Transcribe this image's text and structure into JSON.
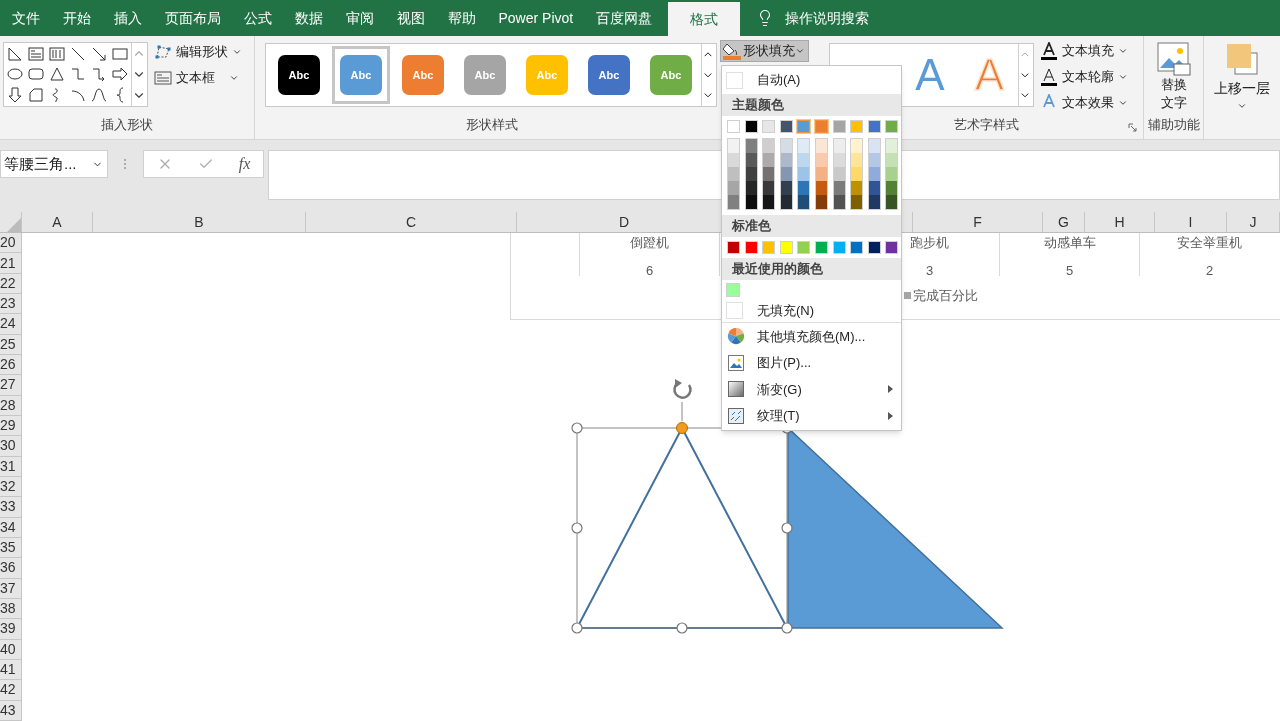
{
  "tabs": [
    {
      "label": "文件",
      "selected": false
    },
    {
      "label": "开始",
      "selected": false
    },
    {
      "label": "插入",
      "selected": false
    },
    {
      "label": "页面布局",
      "selected": false
    },
    {
      "label": "公式",
      "selected": false
    },
    {
      "label": "数据",
      "selected": false
    },
    {
      "label": "审阅",
      "selected": false
    },
    {
      "label": "视图",
      "selected": false
    },
    {
      "label": "帮助",
      "selected": false
    },
    {
      "label": "Power Pivot",
      "selected": false
    },
    {
      "label": "百度网盘",
      "selected": false
    },
    {
      "label": "格式",
      "selected": true
    }
  ],
  "search": {
    "label": "操作说明搜索"
  },
  "insert_shapes": {
    "buttons": [
      "编辑形状",
      "文本框"
    ],
    "label": "插入形状"
  },
  "shape_styles": {
    "label": "形状样式",
    "styles": [
      {
        "text": "Abc",
        "color": "#000000",
        "selected": false
      },
      {
        "text": "Abc",
        "color": "#5b9bd5",
        "selected": true
      },
      {
        "text": "Abc",
        "color": "#ed7d31",
        "selected": false
      },
      {
        "text": "Abc",
        "color": "#a5a5a5",
        "selected": false
      },
      {
        "text": "Abc",
        "color": "#ffc000",
        "selected": false
      },
      {
        "text": "Abc",
        "color": "#4472c4",
        "selected": false
      },
      {
        "text": "Abc",
        "color": "#70ad47",
        "selected": false
      }
    ]
  },
  "shape_fill_button": {
    "label": "形状填充",
    "expanded": true
  },
  "wordart": {
    "label": "艺术字样式",
    "samples": [
      {
        "text": "A",
        "kind": "fill",
        "color": "#5b9bd5"
      },
      {
        "text": "A",
        "kind": "outline",
        "color": "#ed7d31"
      }
    ],
    "buttons": [
      "文本填充",
      "文本轮廓",
      "文本效果"
    ]
  },
  "accessibility": {
    "button": "替换文字",
    "label": "辅助功能"
  },
  "arrange": {
    "button": "上移一层"
  },
  "name_box": "等腰三角...",
  "formula_bar": {
    "function_label": "fx"
  },
  "columns": [
    "A",
    "B",
    "C",
    "D",
    "F",
    "G",
    "H",
    "I",
    "J"
  ],
  "rows": [
    "20",
    "21",
    "22",
    "23",
    "24",
    "25",
    "26",
    "27",
    "28",
    "29",
    "30",
    "31",
    "32",
    "33",
    "34",
    "35",
    "36",
    "37",
    "38",
    "39",
    "40",
    "41",
    "42",
    "43"
  ],
  "chart_table": {
    "cells": [
      {
        "name": "倒蹬机",
        "value": "6"
      },
      {
        "name": "跑步机",
        "value": "3"
      },
      {
        "name": "动感单车",
        "value": "5"
      },
      {
        "name": "安全举重机",
        "value": "2"
      }
    ],
    "legend": "完成百分比"
  },
  "fill_menu": {
    "auto": "自动(A)",
    "theme_header": "主题颜色",
    "theme_colors": [
      {
        "color": "#ffffff",
        "selected": false
      },
      {
        "color": "#000000",
        "selected": false
      },
      {
        "color": "#e7e6e6",
        "selected": false
      },
      {
        "color": "#44546a",
        "selected": false
      },
      {
        "color": "#5b9bd5",
        "selected": true
      },
      {
        "color": "#ed7d31",
        "selected": true
      },
      {
        "color": "#a5a5a5",
        "selected": false
      },
      {
        "color": "#ffc000",
        "selected": false
      },
      {
        "color": "#4472c4",
        "selected": false
      },
      {
        "color": "#70ad47",
        "selected": false
      }
    ],
    "shades": [
      {
        "colors": [
          {
            "color": "#f2f2f2"
          },
          {
            "color": "#d9d9d9"
          },
          {
            "color": "#bfbfbf"
          },
          {
            "color": "#a6a6a6"
          },
          {
            "color": "#808080"
          }
        ]
      },
      {
        "colors": [
          {
            "color": "#7f7f7f"
          },
          {
            "color": "#595959"
          },
          {
            "color": "#404040"
          },
          {
            "color": "#262626"
          },
          {
            "color": "#0d0d0d"
          }
        ]
      },
      {
        "colors": [
          {
            "color": "#d0cece"
          },
          {
            "color": "#aeaaaa"
          },
          {
            "color": "#757171"
          },
          {
            "color": "#3a3838"
          },
          {
            "color": "#171616"
          }
        ]
      },
      {
        "colors": [
          {
            "color": "#d6dce4"
          },
          {
            "color": "#adb9ca"
          },
          {
            "color": "#8497b0"
          },
          {
            "color": "#333f4f"
          },
          {
            "color": "#222b35"
          }
        ]
      },
      {
        "colors": [
          {
            "color": "#deebf6"
          },
          {
            "color": "#bdd7ee"
          },
          {
            "color": "#9dc3e6"
          },
          {
            "color": "#2e75b5"
          },
          {
            "color": "#1f4e79"
          }
        ]
      },
      {
        "colors": [
          {
            "color": "#fbe5d5"
          },
          {
            "color": "#f8cbad"
          },
          {
            "color": "#f4b183"
          },
          {
            "color": "#c55a11"
          },
          {
            "color": "#843c0b"
          }
        ]
      },
      {
        "colors": [
          {
            "color": "#ededed"
          },
          {
            "color": "#dbdbdb"
          },
          {
            "color": "#c9c9c9"
          },
          {
            "color": "#7b7b7b"
          },
          {
            "color": "#525252"
          }
        ]
      },
      {
        "colors": [
          {
            "color": "#fff2cc"
          },
          {
            "color": "#fee599"
          },
          {
            "color": "#ffd965"
          },
          {
            "color": "#bf9000"
          },
          {
            "color": "#7f6000"
          }
        ]
      },
      {
        "colors": [
          {
            "color": "#dae3f3"
          },
          {
            "color": "#b4c7e7"
          },
          {
            "color": "#8faadc"
          },
          {
            "color": "#2f5597"
          },
          {
            "color": "#203864"
          }
        ]
      },
      {
        "colors": [
          {
            "color": "#e2f0d9"
          },
          {
            "color": "#c5e0b4"
          },
          {
            "color": "#a9d18e"
          },
          {
            "color": "#548235"
          },
          {
            "color": "#375623"
          }
        ]
      }
    ],
    "standard_header": "标准色",
    "standard_colors": [
      {
        "color": "#c00000"
      },
      {
        "color": "#ff0000"
      },
      {
        "color": "#ffc000"
      },
      {
        "color": "#ffff00"
      },
      {
        "color": "#92d050"
      },
      {
        "color": "#00b050"
      },
      {
        "color": "#00b0f0"
      },
      {
        "color": "#0070c0"
      },
      {
        "color": "#002060"
      },
      {
        "color": "#7030a0"
      }
    ],
    "recent_header": "最近使用的颜色",
    "recent_colors": [
      {
        "color": "#99ff99"
      }
    ],
    "no_fill": "无填充(N)",
    "items": [
      {
        "label": "其他填充颜色(M)...",
        "kind": "palette",
        "submenu": false
      },
      {
        "label": "图片(P)...",
        "kind": "picture",
        "submenu": false
      },
      {
        "label": "渐变(G)",
        "kind": "gradient",
        "submenu": true
      },
      {
        "label": "纹理(T)",
        "kind": "texture",
        "submenu": true
      }
    ]
  },
  "shapes": [
    {
      "kind": "isosceles-triangle",
      "selected": true
    },
    {
      "kind": "right-triangle",
      "color": "#5b9bd5"
    }
  ]
}
